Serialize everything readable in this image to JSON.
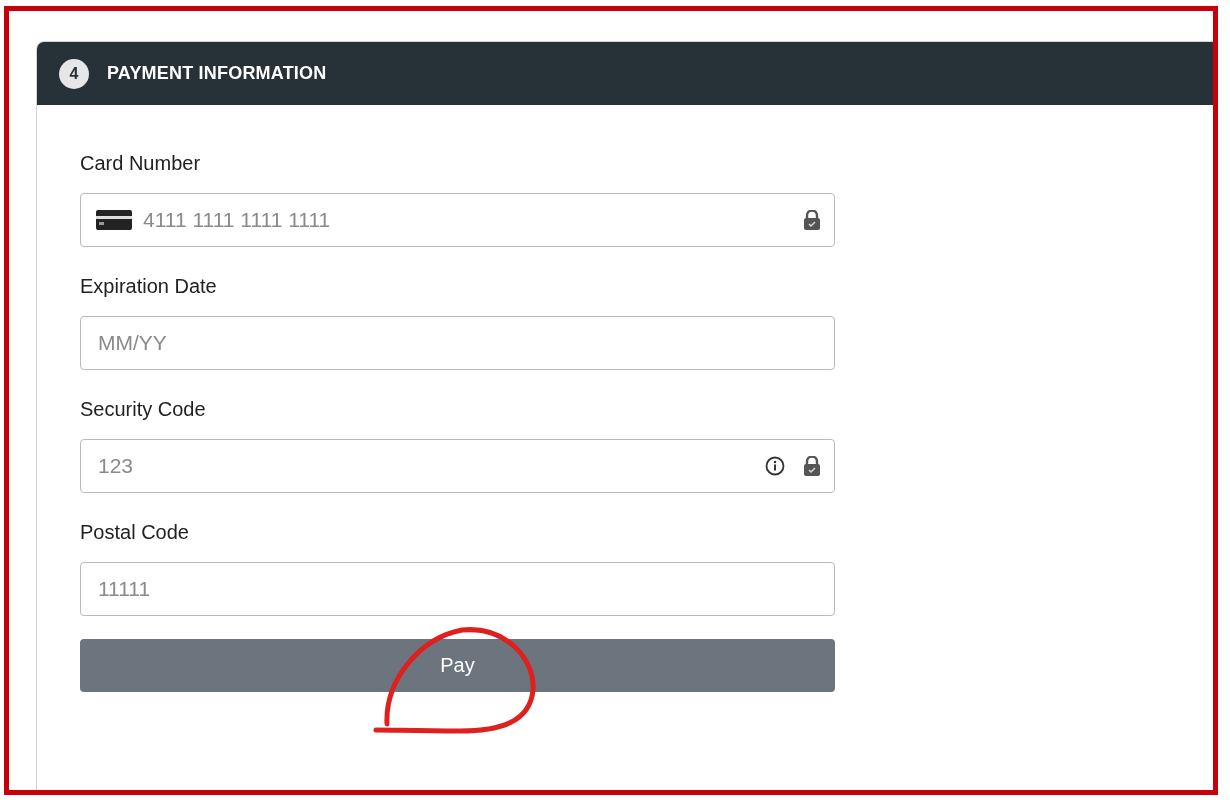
{
  "section": {
    "number": "4",
    "title": "PAYMENT INFORMATION"
  },
  "fields": [
    {
      "label": "Card Number",
      "placeholder": "4111 1111 1111 1111",
      "card_icon": true,
      "has_help": false,
      "secure": true
    },
    {
      "label": "Expiration Date",
      "placeholder": "MM/YY",
      "card_icon": false,
      "has_help": false,
      "secure": false
    },
    {
      "label": "Security Code",
      "placeholder": "123",
      "card_icon": false,
      "has_help": true,
      "secure": true
    },
    {
      "label": "Postal Code",
      "placeholder": "11111",
      "card_icon": false,
      "has_help": false,
      "secure": false
    }
  ],
  "submit": {
    "label": "Pay"
  }
}
